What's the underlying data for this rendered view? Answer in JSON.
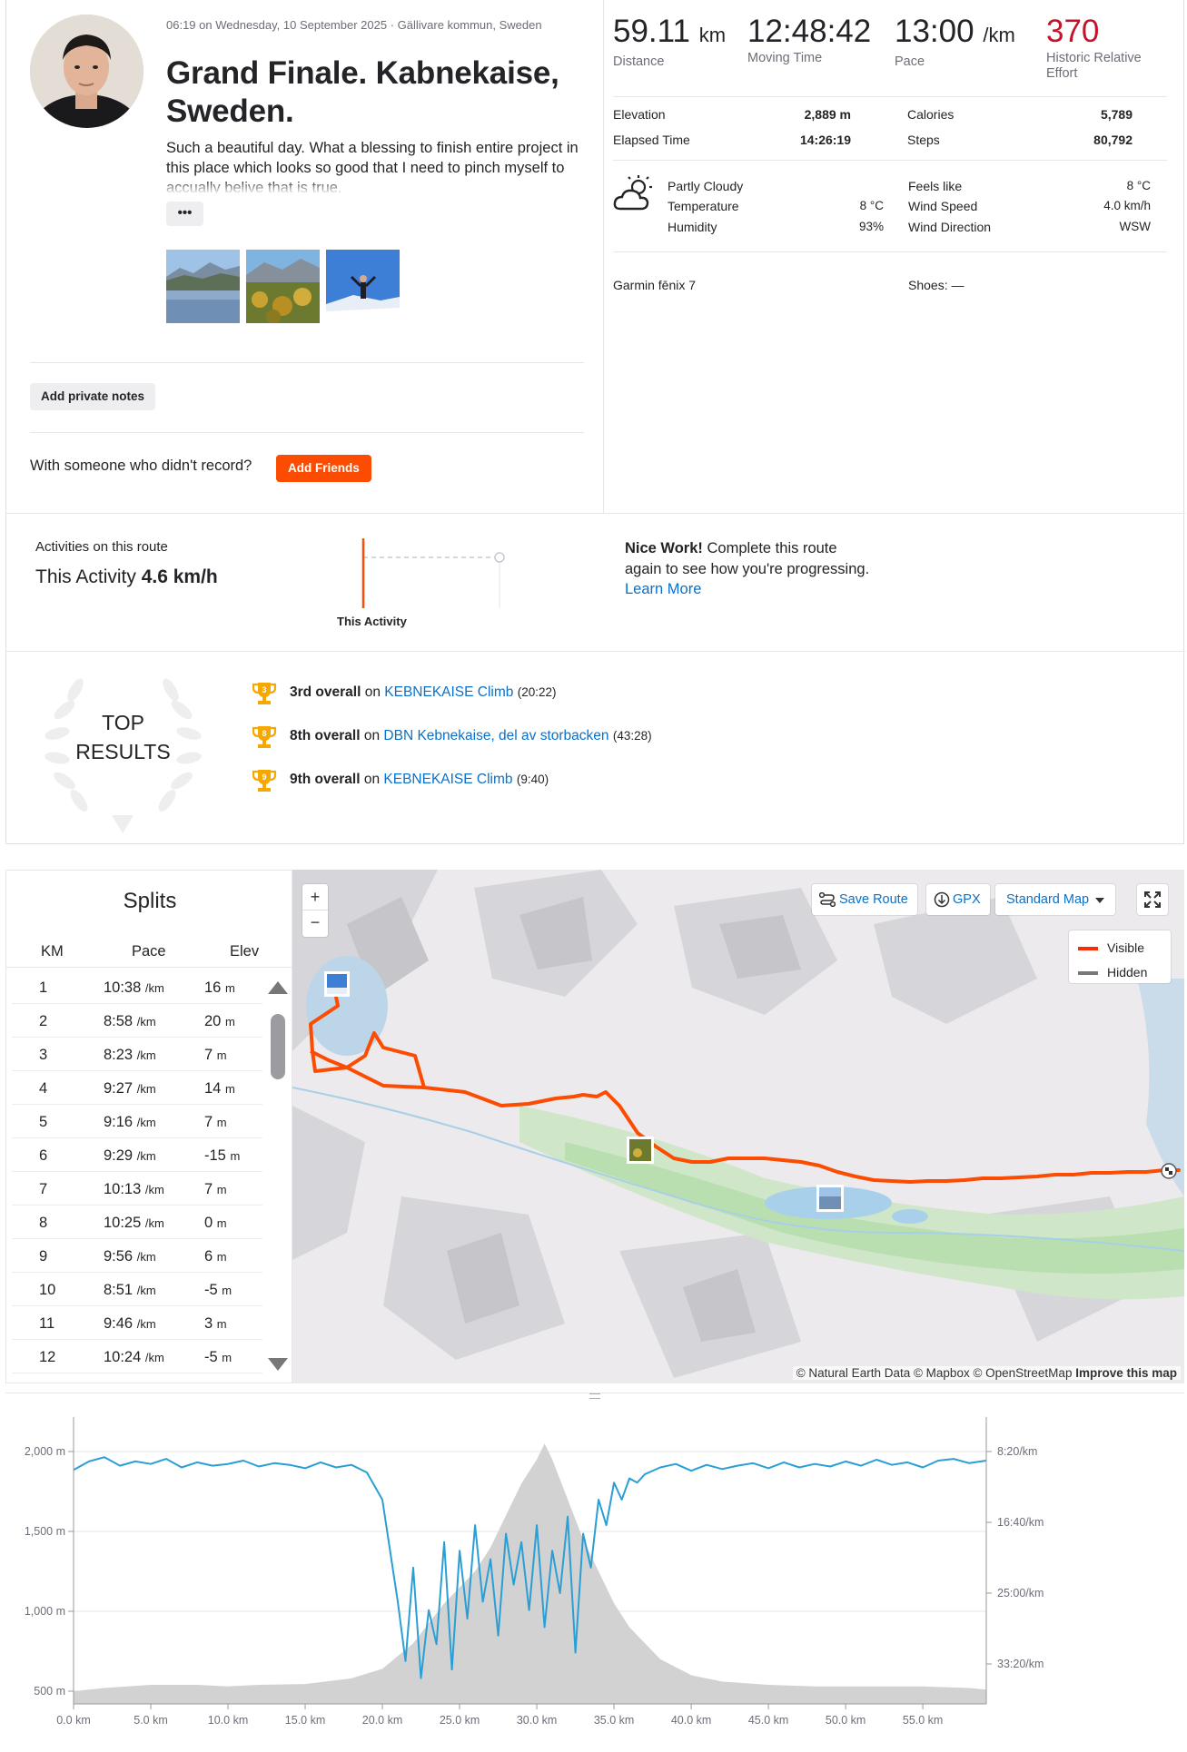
{
  "activity": {
    "meta": "06:19 on Wednesday, 10 September 2025 · Gällivare kommun, Sweden",
    "title": "Grand Finale. Kabnekaise, Sweden.",
    "description": "Such a beautiful day. What a blessing to finish entire project in this place which looks so good that I need to pinch myself to accually belive that is true.",
    "more_label": "•••",
    "add_notes_label": "Add private notes",
    "with_someone_text": "With someone who didn't record?",
    "add_friends_label": "Add Friends"
  },
  "stats": {
    "distance": {
      "value": "59.11",
      "unit": "km",
      "label": "Distance"
    },
    "moving_time": {
      "value": "12:48:42",
      "label": "Moving Time"
    },
    "pace": {
      "value": "13:00",
      "unit": "/km",
      "label": "Pace"
    },
    "effort": {
      "value": "370",
      "label": "Historic Relative Effort",
      "color": "#c3152a"
    },
    "elevation_label": "Elevation",
    "elevation_value": "2,889 m",
    "calories_label": "Calories",
    "calories_value": "5,789",
    "elapsed_label": "Elapsed Time",
    "elapsed_value": "14:26:19",
    "steps_label": "Steps",
    "steps_value": "80,792"
  },
  "weather": {
    "icon": "partly-cloudy-icon",
    "condition": "Partly Cloudy",
    "temperature_label": "Temperature",
    "temperature_value": "8 °C",
    "humidity_label": "Humidity",
    "humidity_value": "93%",
    "feels_like_label": "Feels like",
    "feels_like_value": "8 °C",
    "wind_speed_label": "Wind Speed",
    "wind_speed_value": "4.0 km/h",
    "wind_dir_label": "Wind Direction",
    "wind_dir_value": "WSW"
  },
  "gear": {
    "device": "Garmin fēnix 7",
    "shoes": "Shoes: —"
  },
  "route": {
    "section_label": "Activities on this route",
    "this_activity_label": "This Activity",
    "this_activity_value": "4.6 km/h",
    "chart_caption": "This Activity",
    "nice_bold": "Nice Work!",
    "nice_text": "Complete this route again to see how you're progressing.",
    "learn_more": "Learn More"
  },
  "top_results": {
    "title_line1": "TOP",
    "title_line2": "RESULTS",
    "items": [
      {
        "rank_badge": "3",
        "place": "3rd overall",
        "on": "on",
        "segment": "KEBNEKAISE Climb",
        "time": "(20:22)"
      },
      {
        "rank_badge": "8",
        "place": "8th overall",
        "on": "on",
        "segment": "DBN Kebnekaise, del av storbacken",
        "time": "(43:28)"
      },
      {
        "rank_badge": "9",
        "place": "9th overall",
        "on": "on",
        "segment": "KEBNEKAISE Climb",
        "time": "(9:40)"
      }
    ],
    "trophy_color": "#f7a800"
  },
  "splits": {
    "title": "Splits",
    "headers": [
      "KM",
      "Pace",
      "Elev"
    ],
    "pace_unit": "/km",
    "elev_unit": "m",
    "rows": [
      {
        "km": "1",
        "pace": "10:38",
        "elev": "16"
      },
      {
        "km": "2",
        "pace": "8:58",
        "elev": "20"
      },
      {
        "km": "3",
        "pace": "8:23",
        "elev": "7"
      },
      {
        "km": "4",
        "pace": "9:27",
        "elev": "14"
      },
      {
        "km": "5",
        "pace": "9:16",
        "elev": "7"
      },
      {
        "km": "6",
        "pace": "9:29",
        "elev": "-15"
      },
      {
        "km": "7",
        "pace": "10:13",
        "elev": "7"
      },
      {
        "km": "8",
        "pace": "10:25",
        "elev": "0"
      },
      {
        "km": "9",
        "pace": "9:56",
        "elev": "6"
      },
      {
        "km": "10",
        "pace": "8:51",
        "elev": "-5"
      },
      {
        "km": "11",
        "pace": "9:46",
        "elev": "3"
      },
      {
        "km": "12",
        "pace": "10:24",
        "elev": "-5"
      }
    ]
  },
  "map": {
    "zoom_in": "+",
    "zoom_out": "−",
    "save_route": "Save Route",
    "gpx": "GPX",
    "map_style": "Standard Map",
    "legend_visible": "Visible",
    "legend_hidden": "Hidden",
    "attribution": "© Natural Earth Data © Mapbox © OpenStreetMap",
    "improve": "Improve this map",
    "route_color": "#fc4c02"
  },
  "chart_data": {
    "type": "area",
    "title": "",
    "xlabel": "",
    "x_unit": "km",
    "x_ticks": [
      "0.0 km",
      "5.0 km",
      "10.0 km",
      "15.0 km",
      "20.0 km",
      "25.0 km",
      "30.0 km",
      "35.0 km",
      "40.0 km",
      "45.0 km",
      "50.0 km",
      "55.0 km"
    ],
    "xlim": [
      0,
      59.11
    ],
    "y_left_ticks": [
      "500 m",
      "1,000 m",
      "1,500 m",
      "2,000 m"
    ],
    "ylim_elevation": [
      500,
      2000
    ],
    "y_right_ticks": [
      "8:20/km",
      "16:40/km",
      "25:00/km",
      "33:20/km"
    ],
    "grid": true,
    "series": [
      {
        "type": "area",
        "color": "#c8c8c8",
        "x": [
          0,
          2,
          5,
          8,
          10,
          12,
          15,
          18,
          20,
          22,
          24,
          26,
          27,
          28,
          29,
          30,
          30.5,
          31,
          32,
          33,
          34,
          35,
          36,
          38,
          40,
          42,
          45,
          48,
          50,
          52,
          55,
          58,
          59.11
        ],
        "values": [
          500,
          520,
          540,
          540,
          530,
          540,
          545,
          580,
          640,
          800,
          1050,
          1250,
          1400,
          1600,
          1800,
          1950,
          2050,
          1950,
          1700,
          1450,
          1250,
          1050,
          900,
          700,
          600,
          560,
          540,
          530,
          530,
          530,
          530,
          520,
          510
        ]
      },
      {
        "type": "line",
        "color": "#2a9fd6",
        "x": [
          0,
          1,
          2,
          3,
          4,
          5,
          6,
          7,
          8,
          9,
          10,
          11,
          12,
          13,
          14,
          15,
          16,
          17,
          18,
          19,
          20,
          20.5,
          21,
          21.5,
          22,
          22.5,
          23,
          23.5,
          24,
          24.5,
          25,
          25.5,
          26,
          26.5,
          27,
          27.5,
          28,
          28.5,
          29,
          29.5,
          30,
          30.5,
          31,
          31.5,
          32,
          32.5,
          33,
          33.5,
          34,
          34.5,
          35,
          35.5,
          36,
          36.5,
          37,
          38,
          39,
          40,
          41,
          42,
          43,
          44,
          45,
          46,
          47,
          48,
          49,
          50,
          51,
          52,
          53,
          54,
          55,
          56,
          57,
          58,
          59.11
        ],
        "values_pace_min_per_km": [
          10.5,
          9.5,
          9.0,
          10.0,
          9.5,
          9.8,
          9.2,
          10.2,
          9.6,
          10.0,
          9.8,
          9.4,
          10.1,
          9.7,
          9.9,
          10.3,
          9.6,
          10.2,
          9.9,
          10.8,
          14.0,
          20.0,
          26.0,
          33.0,
          22.0,
          35.0,
          27.0,
          31.0,
          19.0,
          34.0,
          20.0,
          28.0,
          17.0,
          26.0,
          21.0,
          30.0,
          18.0,
          24.0,
          19.0,
          27.0,
          17.0,
          29.0,
          20.0,
          25.0,
          16.0,
          32.0,
          18.0,
          22.0,
          14.0,
          17.0,
          12.0,
          14.0,
          11.5,
          12.0,
          11.0,
          10.2,
          9.8,
          10.6,
          9.9,
          10.4,
          10.0,
          9.7,
          10.3,
          9.6,
          10.2,
          9.8,
          10.1,
          9.5,
          10.0,
          9.3,
          9.9,
          9.6,
          10.2,
          9.4,
          9.2,
          9.7,
          9.4
        ]
      }
    ]
  }
}
